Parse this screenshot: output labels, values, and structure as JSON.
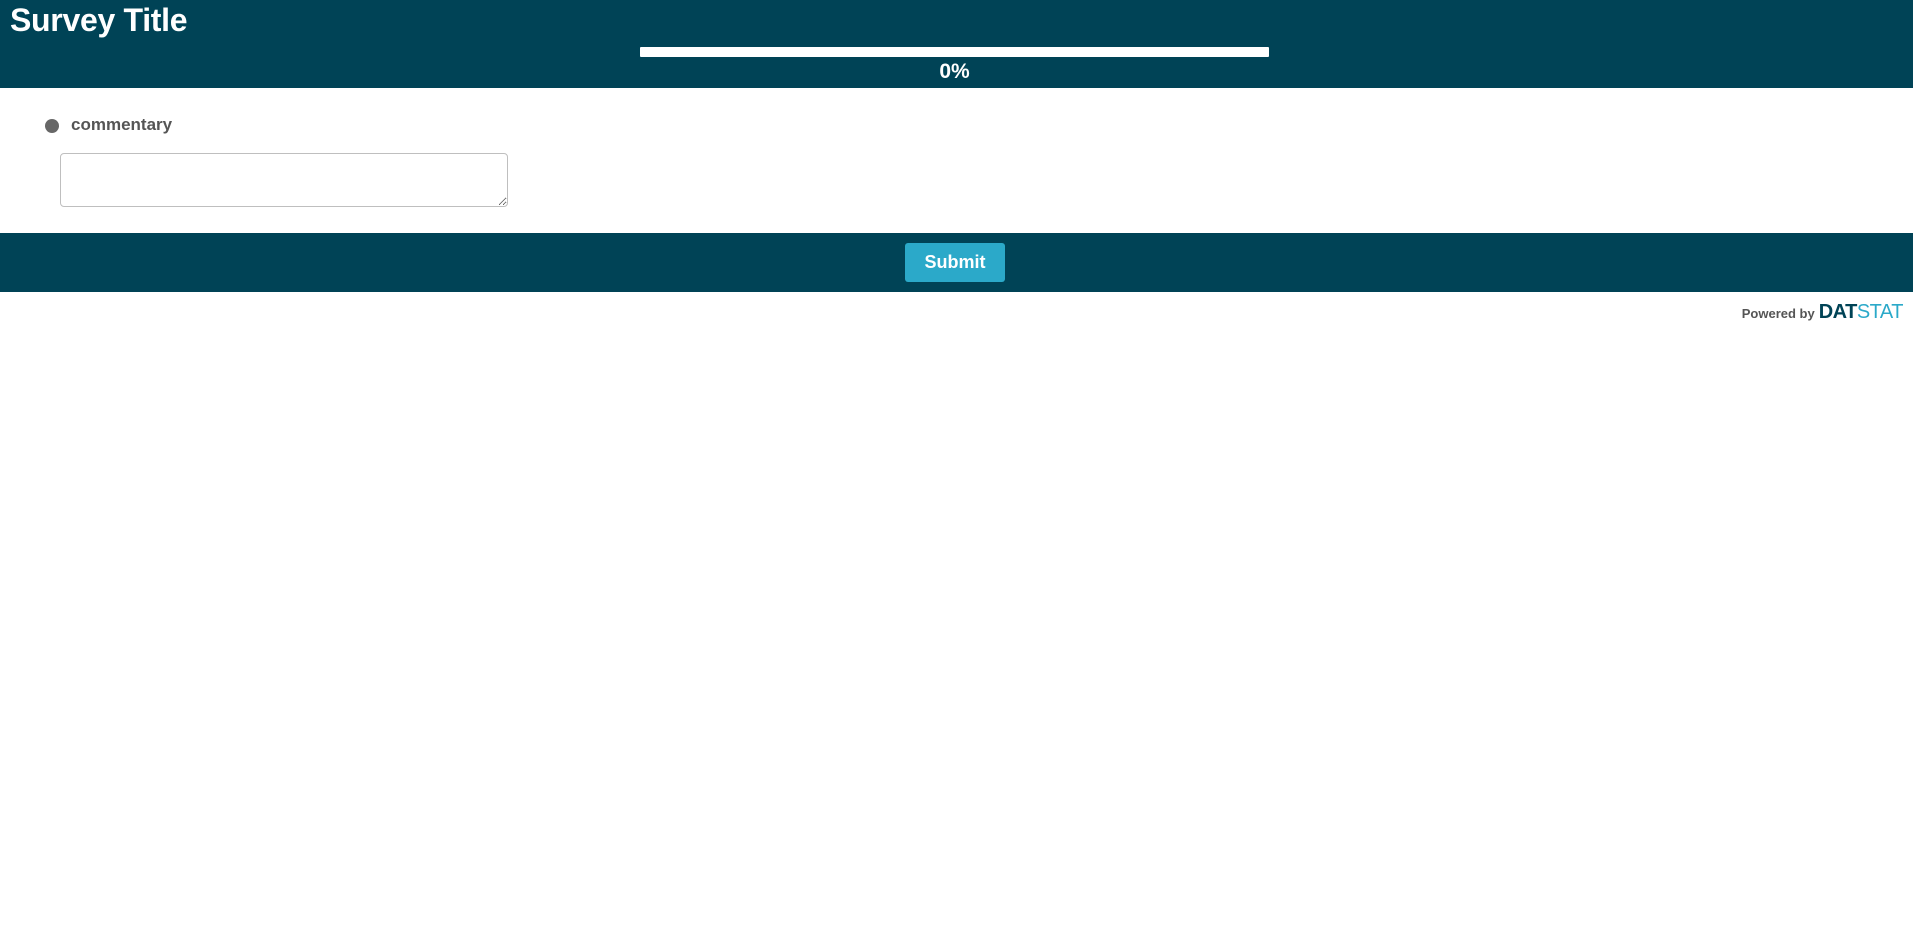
{
  "header": {
    "title": "Survey Title",
    "progress": {
      "value_percent": 0,
      "label": "0%"
    }
  },
  "question": {
    "label": "commentary",
    "answer_value": "",
    "answer_placeholder": ""
  },
  "footer": {
    "submit_label": "Submit"
  },
  "branding": {
    "powered_by": "Powered by",
    "logo_part1": "DAT",
    "logo_part2": "STAT"
  },
  "colors": {
    "header_bg": "#004356",
    "accent": "#2ba9c9",
    "text_muted": "#555555"
  }
}
